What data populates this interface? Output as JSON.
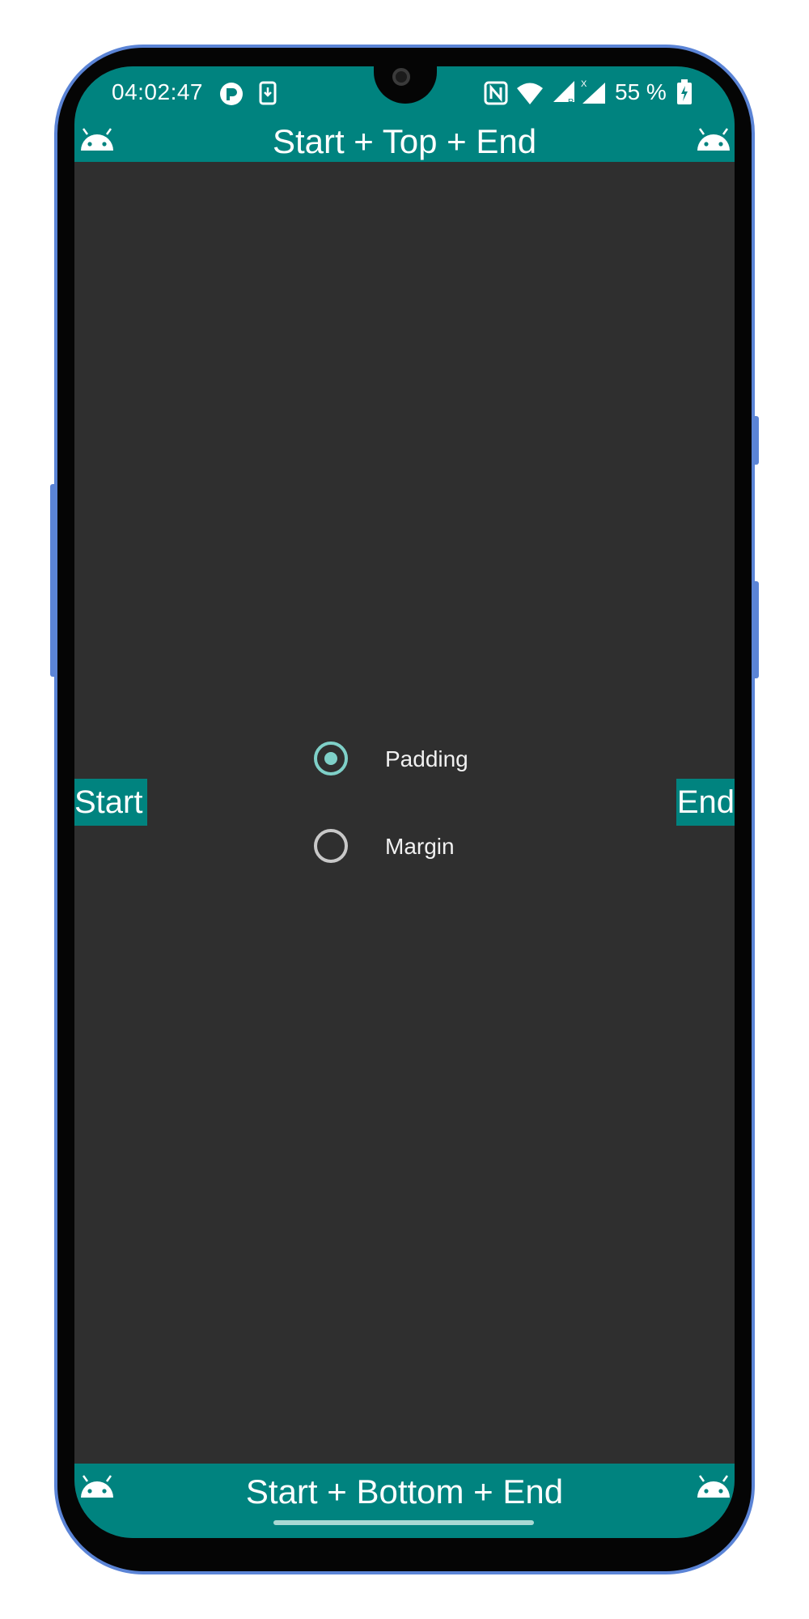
{
  "status_bar": {
    "time": "04:02:47",
    "battery": "55 %",
    "icons": [
      "app-r-icon",
      "download-icon",
      "nfc-icon",
      "wifi-icon",
      "signal-r-icon",
      "signal-x-icon",
      "battery-charging-icon"
    ]
  },
  "header": {
    "title": "Start + Top + End"
  },
  "sides": {
    "start": "Start",
    "end": "End"
  },
  "radio_group": {
    "options": [
      {
        "label": "Padding",
        "checked": true
      },
      {
        "label": "Margin",
        "checked": false
      }
    ]
  },
  "footer": {
    "title": "Start + Bottom + End"
  },
  "colors": {
    "teal": "#00837f",
    "background": "#2f2f2f",
    "radio_accent": "#7fd0c8",
    "frame": "#5b84d6"
  }
}
